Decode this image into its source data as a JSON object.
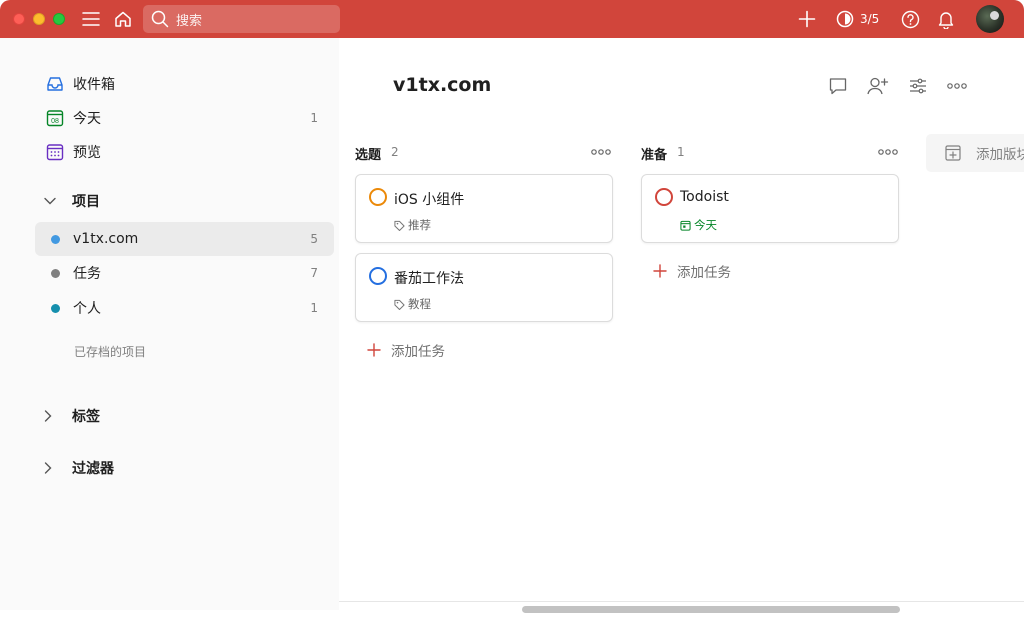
{
  "topbar": {
    "search_placeholder": "搜索",
    "karma": "3/5",
    "colors": {
      "bar": "#d1453b"
    },
    "icons": [
      "menu-icon",
      "home-icon",
      "search-icon",
      "add-icon",
      "karma-icon",
      "help-icon",
      "bell-icon"
    ]
  },
  "sidebar": {
    "items": [
      {
        "label": "收件箱",
        "count": "",
        "icon": "inbox-icon",
        "color": "#246fe0"
      },
      {
        "label": "今天",
        "count": "1",
        "icon": "calendar-today-icon",
        "icon_text": "08",
        "color": "#058527"
      },
      {
        "label": "预览",
        "count": "",
        "icon": "calendar-upcoming-icon",
        "color": "#692fc2"
      }
    ],
    "projects_label": "项目",
    "projects": [
      {
        "label": "v1tx.com",
        "count": "5",
        "color": "#4299e1"
      },
      {
        "label": "任务",
        "count": "7",
        "color": "#808080"
      },
      {
        "label": "个人",
        "count": "1",
        "color": "#158fad"
      }
    ],
    "archived_label": "已存档的项目",
    "labels_label": "标签",
    "filters_label": "过滤器"
  },
  "main": {
    "title": "v1tx.com",
    "add_section_label": "添加版块",
    "columns": [
      {
        "title": "选题",
        "count": "2",
        "add_task": "添加任务",
        "tasks": [
          {
            "name": "iOS 小组件",
            "tag": "推荐",
            "circle_color": "#eb8909",
            "tag_icon": "tag-icon"
          },
          {
            "name": "番茄工作法",
            "tag": "教程",
            "circle_color": "#246fe0",
            "tag_icon": "tag-icon"
          }
        ]
      },
      {
        "title": "准备",
        "count": "1",
        "add_task": "添加任务",
        "tasks": [
          {
            "name": "Todoist",
            "tag": "今天",
            "circle_color": "#d1453b",
            "tag_icon": "calendar-icon",
            "tag_color": "#058527"
          }
        ]
      }
    ]
  }
}
